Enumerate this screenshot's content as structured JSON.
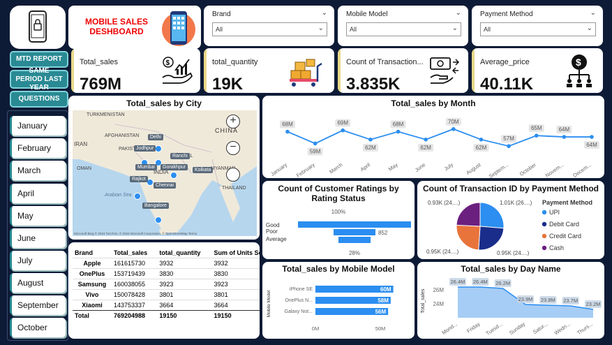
{
  "header": {
    "title_line1": "MOBILE SALES",
    "title_line2": "DESHBOARD"
  },
  "slicers": [
    {
      "label": "Brand",
      "value": "All"
    },
    {
      "label": "Mobile Model",
      "value": "All"
    },
    {
      "label": "Payment Method",
      "value": "All"
    }
  ],
  "nav": {
    "mtd": "MTD REPORT",
    "same_period": "SAME PERIOD LAST YEAR",
    "questions": "QUESTIONS"
  },
  "months": [
    "January",
    "February",
    "March",
    "April",
    "May",
    "June",
    "July",
    "August",
    "September",
    "October"
  ],
  "kpis": [
    {
      "label": "Total_sales",
      "value": "769M",
      "icon": "money-hand-chart-icon"
    },
    {
      "label": "total_quantity",
      "value": "19K",
      "icon": "boxes-trolley-icon"
    },
    {
      "label": "Count of Transaction...",
      "value": "3.835K",
      "icon": "cash-exchange-icon"
    },
    {
      "label": "Average_price",
      "value": "40.11K",
      "icon": "dollar-hierarchy-icon"
    }
  ],
  "map": {
    "title": "Total_sales by City",
    "countries": [
      "TURKMENISTAN",
      "CHINA",
      "AFGHANISTAN",
      "PAKISTAN",
      "IRAN",
      "NEPAL",
      "OMAN",
      "INDIA",
      "MYANMAR",
      "THAILAND"
    ],
    "sea": "Arabian Sea",
    "cities": [
      "Delhi",
      "Jodhpur",
      "Ranchi",
      "Mumbai",
      "Gorakhpur",
      "Kolkata",
      "Rajkot",
      "Chennai",
      "Bangalore"
    ],
    "attribution": "Microsoft Bing © 2024 TomTom, © 2024 Microsoft Corporation, © OpenStreetMap  Terms"
  },
  "brand_table": {
    "headers": [
      "Brand",
      "Total_sales",
      "total_quantity",
      "Sum of Units Sold"
    ],
    "rows": [
      [
        "Apple",
        "161615730",
        "3932",
        "3932"
      ],
      [
        "OnePlus",
        "153719439",
        "3830",
        "3830"
      ],
      [
        "Samsung",
        "160038055",
        "3923",
        "3923"
      ],
      [
        "Vivo",
        "150078428",
        "3801",
        "3801"
      ],
      [
        "Xiaomi",
        "143753337",
        "3664",
        "3664"
      ]
    ],
    "total": [
      "Total",
      "769204988",
      "19150",
      "19150"
    ]
  },
  "chart_data": [
    {
      "type": "line",
      "title": "Total_sales by Month",
      "categories": [
        "January",
        "February",
        "March",
        "April",
        "May",
        "June",
        "July",
        "August",
        "Septem...",
        "October",
        "Novem...",
        "Decem..."
      ],
      "values": [
        68,
        59,
        69,
        62,
        68,
        62,
        70,
        62,
        57,
        65,
        64,
        64
      ],
      "labels": [
        "68M",
        "59M",
        "69M",
        "62M",
        "68M",
        "62M",
        "70M",
        "62M",
        "57M",
        "65M",
        "64M",
        "64M"
      ],
      "color": "#2b8ef0"
    },
    {
      "type": "bar",
      "title": "Count of Customer Ratings by Rating Status",
      "categories": [
        "Good",
        "Poor",
        "Average"
      ],
      "values": [
        100,
        852,
        28
      ],
      "labels": [
        "100%",
        "852",
        "28%"
      ],
      "color": "#2b8ef0"
    },
    {
      "type": "pie",
      "title": "Count of Transaction ID by Payment Method",
      "legend_title": "Payment Method",
      "categories": [
        "UPI",
        "Debit Card",
        "Credit Card",
        "Cash"
      ],
      "values": [
        1010,
        950,
        950,
        930
      ],
      "labels": [
        "1.01K (26....)",
        "0.95K (24....)",
        "0.95K (24....)",
        "0.93K (24....)"
      ],
      "colors": [
        "#2b8ef0",
        "#1a2d8a",
        "#e8743b",
        "#6b1f7f"
      ]
    },
    {
      "type": "bar",
      "title": "Total_sales by Mobile Model",
      "ylabel": "Mobile Model",
      "categories": [
        "iPhone SE",
        "OnePlus N...",
        "Galaxy Not..."
      ],
      "values": [
        60,
        58,
        56
      ],
      "labels": [
        "60M",
        "58M",
        "56M"
      ],
      "xticks": [
        "0M",
        "50M"
      ],
      "color": "#2b8ef0"
    },
    {
      "type": "area",
      "title": "Total_sales by Day Name",
      "ylabel": "Total_sales",
      "categories": [
        "Mond...",
        "Friday",
        "Tuesd...",
        "Sunday",
        "Satur...",
        "Wedn...",
        "Thurs..."
      ],
      "values": [
        26.4,
        26.4,
        26.2,
        23.9,
        23.8,
        23.7,
        23.2
      ],
      "labels": [
        "26.4M",
        "26.4M",
        "26.2M",
        "23.9M",
        "23.8M",
        "23.7M",
        "23.2M"
      ],
      "yticks": [
        "26M",
        "24M"
      ],
      "color": "#2b8ef0"
    }
  ]
}
